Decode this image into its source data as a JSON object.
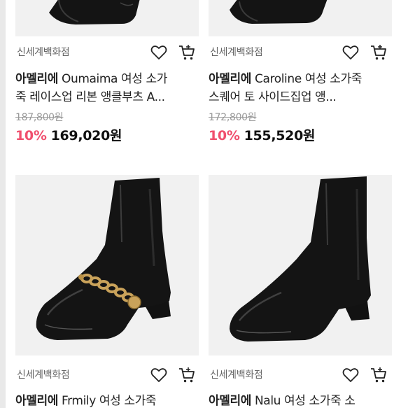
{
  "products": [
    {
      "seller": "신세계백화점",
      "brand": "아멜리에",
      "name": "Oumaima 여성 소가죽 레이스업 리본 앵클부츠 A...",
      "original_price": "187,800원",
      "discount": "10%",
      "price": "169,020원"
    },
    {
      "seller": "신세계백화점",
      "brand": "아멜리에",
      "name": "Caroline 여성 소가죽 스퀘어 토 사이드집업 앵...",
      "original_price": "172,800원",
      "discount": "10%",
      "price": "155,520원"
    },
    {
      "seller": "신세계백화점",
      "brand": "아멜리에",
      "name": "Frmily 여성 소가죽"
    },
    {
      "seller": "신세계백화점",
      "brand": "아멜리에",
      "name": "Nalu 여성 소가죽 소"
    }
  ],
  "icons": {
    "wishlist": "heart-outline-icon",
    "cart": "cart-plus-icon"
  },
  "colors": {
    "discount": "#f0506e",
    "image_bg": "#f1f1f1",
    "boot": "#141414",
    "chain": "#c9a25a"
  }
}
